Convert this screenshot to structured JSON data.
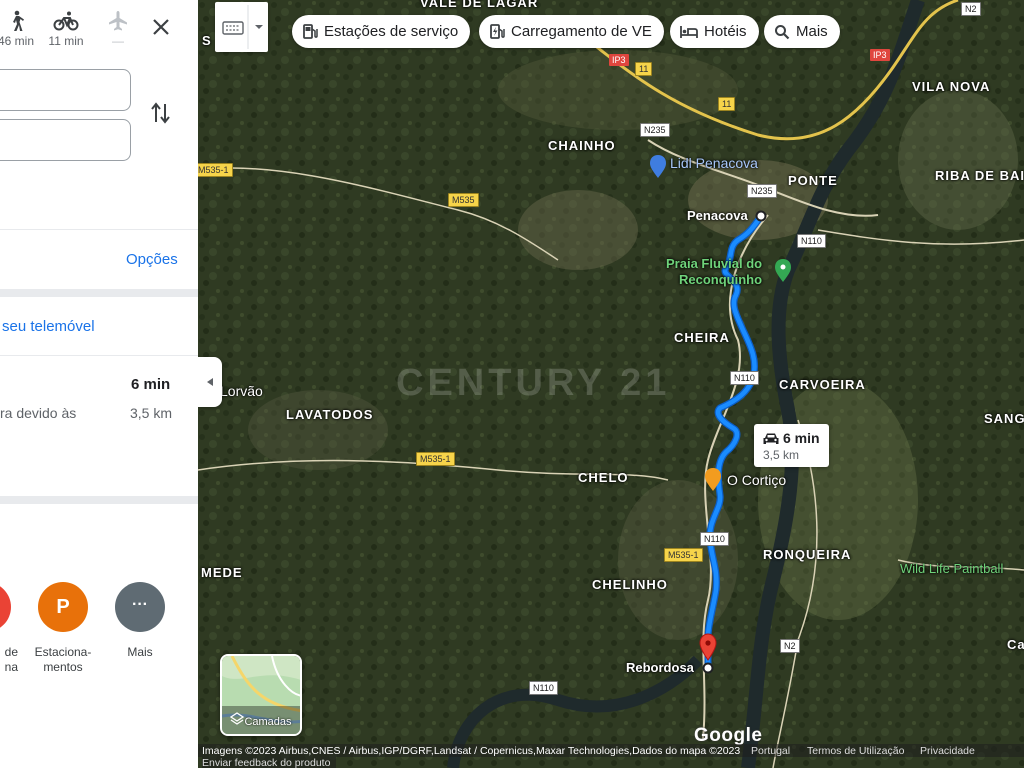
{
  "panel": {
    "modes": [
      {
        "icon": "walk-icon",
        "label": "46 min"
      },
      {
        "icon": "bicycle-icon",
        "label": "11 min"
      },
      {
        "icon": "airplane-icon",
        "label": "—"
      }
    ],
    "options_label": "Opções",
    "send_to_phone_label": "seu telemóvel",
    "route": {
      "time": "6 min",
      "note": "ra devido às",
      "distance": "3,5 km"
    },
    "nearby": [
      {
        "icon": "gas-icon",
        "label_line1": "de",
        "label_line2": "na"
      },
      {
        "icon": "parking-icon",
        "glyph": "P",
        "label_line1": "Estaciona-",
        "label_line2": "mentos"
      },
      {
        "icon": "more-icon",
        "glyph": "···",
        "label_line1": "Mais",
        "label_line2": ""
      }
    ]
  },
  "chips": [
    {
      "icon": "gas-station-icon",
      "label": "Estações de serviço"
    },
    {
      "icon": "ev-charging-icon",
      "label": "Carregamento de VE"
    },
    {
      "icon": "hotel-icon",
      "label": "Hotéis"
    },
    {
      "icon": "search-icon",
      "label": "Mais"
    }
  ],
  "map": {
    "areas": [
      {
        "label": "VALE DE LAGAR"
      },
      {
        "label": "VILA NOVA"
      },
      {
        "label": "CHAINHO"
      },
      {
        "label": "PONTE"
      },
      {
        "label": "RIBA DE BAI"
      },
      {
        "label": "CHEIRA"
      },
      {
        "label": "CARVOEIRA"
      },
      {
        "label": "LAVATODOS"
      },
      {
        "label": "SANG"
      },
      {
        "label": "CHELO"
      },
      {
        "label": "RONQUEIRA"
      },
      {
        "label": "CHELINHO"
      },
      {
        "label": "MEDE"
      },
      {
        "label": "S"
      },
      {
        "label": "Ca"
      }
    ],
    "lorvao": "Lorvão",
    "places": {
      "start": "Penacova",
      "end": "Rebordosa"
    },
    "pois": {
      "lidl": "Lidl Penacova",
      "praia_line1": "Praia Fluvial do",
      "praia_line2": "Reconquinho",
      "cortico": "O Cortiço",
      "paintball": "Wild Life Paintball"
    },
    "roads": [
      "N2",
      "IP3",
      "11",
      "11",
      "IP3",
      "N235",
      "M535-1",
      "N235",
      "M535",
      "N110",
      "N110",
      "M535-1",
      "N110",
      "M535-1",
      "N2",
      "N110"
    ],
    "watermark": "CENTURY 21",
    "callout": {
      "time": "6 min",
      "distance": "3,5 km"
    },
    "layers_label": "Camadas",
    "google": "Google"
  },
  "footer": {
    "attribution": "Imagens ©2023 Airbus,CNES / Airbus,IGP/DGRF,Landsat / Copernicus,Maxar Technologies,Dados do mapa ©2023",
    "portugal": "Portugal",
    "terms": "Termos de Utilização",
    "privacy": "Privacidade",
    "feedback": "Enviar feedback do produto"
  },
  "colors": {
    "route": "#1a8cff",
    "link": "#1a73e8",
    "poi_green": "#6fd37a",
    "pin_red": "#ea4335",
    "parking": "#e8710a",
    "more": "#5f6b73"
  }
}
